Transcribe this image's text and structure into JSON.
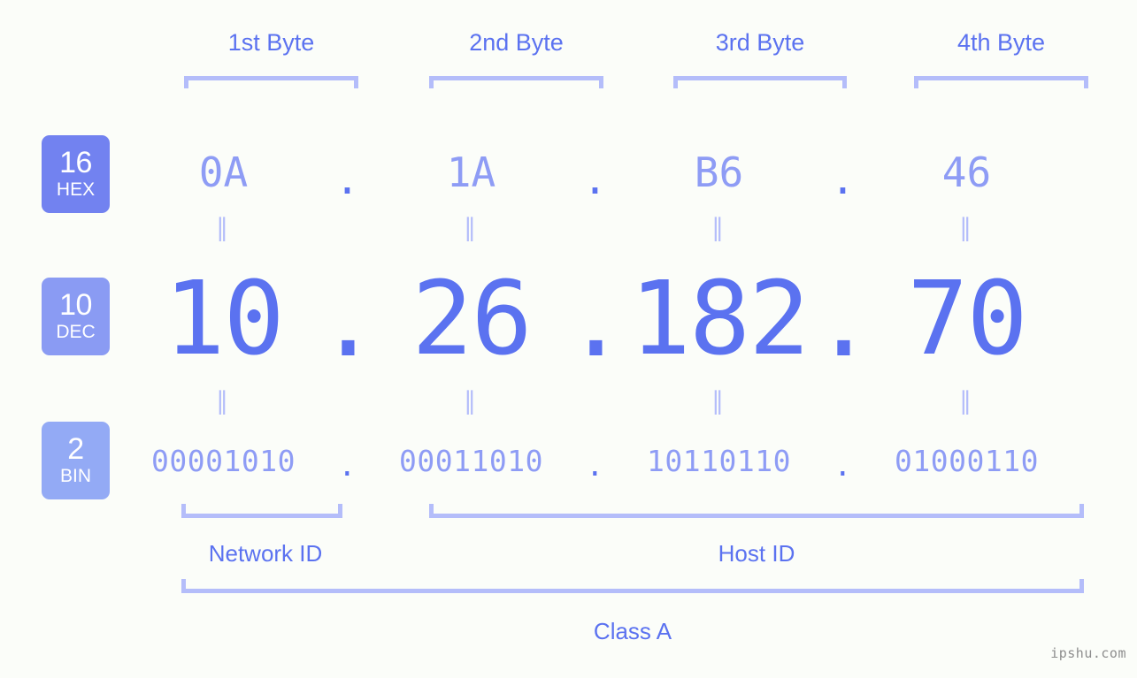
{
  "page": {
    "background": "#fbfdf9",
    "accent": "#5b72f0",
    "accent_light": "#8e9cf5",
    "bracket_color": "#b4bdfa",
    "watermark": "ipshu.com"
  },
  "byte_headers": [
    {
      "label": "1st Byte"
    },
    {
      "label": "2nd Byte"
    },
    {
      "label": "3rd Byte"
    },
    {
      "label": "4th Byte"
    }
  ],
  "bases": [
    {
      "number": "16",
      "abbr": "HEX",
      "color": "#7282f0"
    },
    {
      "number": "10",
      "abbr": "DEC",
      "color": "#8a9bf3"
    },
    {
      "number": "2",
      "abbr": "BIN",
      "color": "#93aaf5"
    }
  ],
  "separator": ".",
  "equality_mark": "=",
  "rows": {
    "hex": {
      "values": [
        "0A",
        "1A",
        "B6",
        "46"
      ]
    },
    "dec": {
      "values": [
        "10",
        "26",
        "182",
        "70"
      ]
    },
    "bin": {
      "values": [
        "00001010",
        "00011010",
        "10110110",
        "01000110"
      ]
    }
  },
  "sections": {
    "network_id": "Network ID",
    "host_id": "Host ID",
    "class": "Class A"
  }
}
